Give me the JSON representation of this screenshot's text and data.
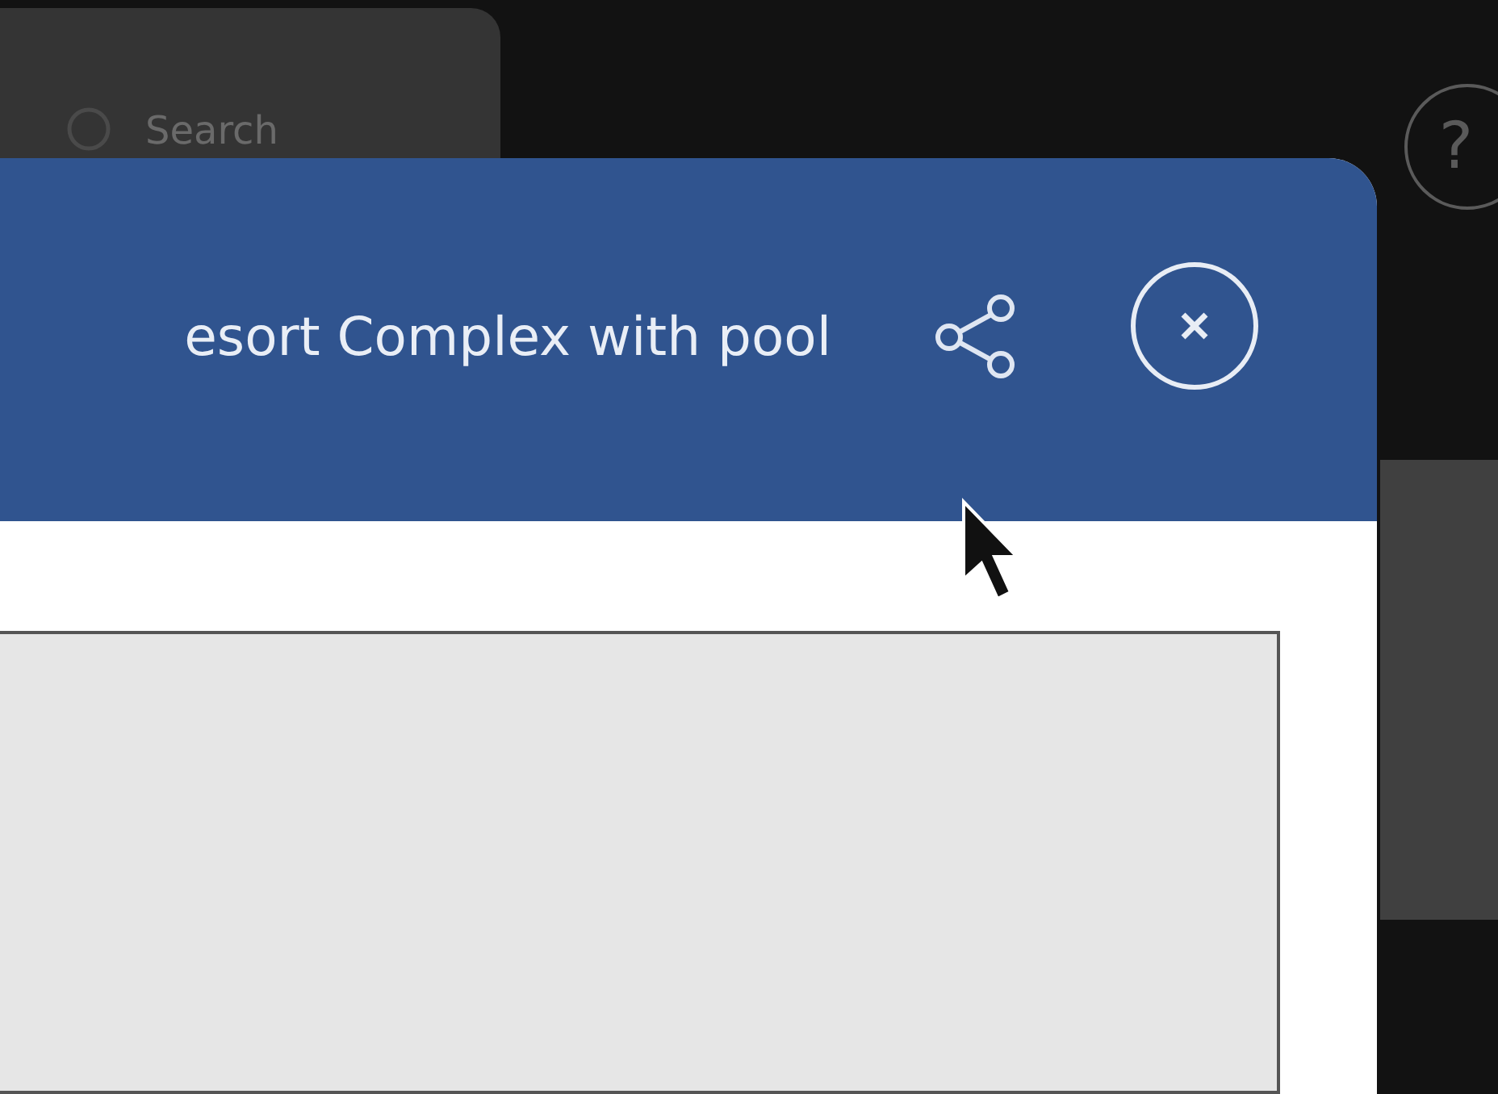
{
  "search": {
    "placeholder": "Search"
  },
  "help": {
    "label": "?"
  },
  "dialog": {
    "title": "esort Complex with pool"
  }
}
